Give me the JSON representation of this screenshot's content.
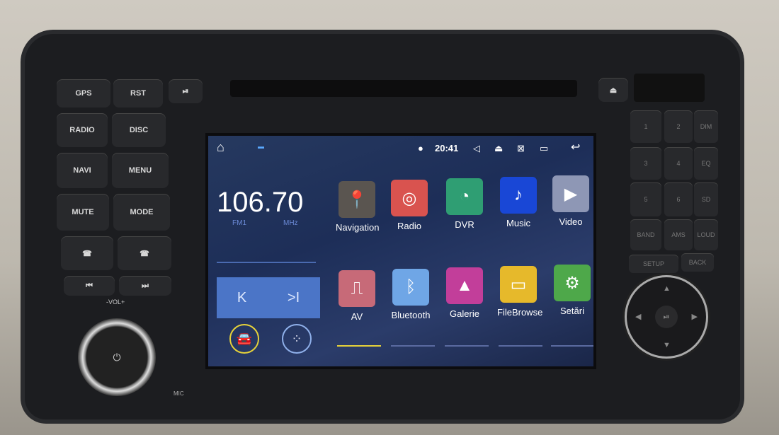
{
  "status_bar": {
    "time": "20:41",
    "icons": [
      "home-icon",
      "notification-icon",
      "location-icon",
      "volume-icon",
      "eject-icon",
      "close-screen-icon",
      "recent-apps-icon",
      "back-icon"
    ]
  },
  "radio": {
    "frequency": "106.70",
    "band": "FM1",
    "unit": "MHz"
  },
  "apps": [
    {
      "label": "Navigation",
      "icon": "location-pin-icon",
      "color": "#5a5550"
    },
    {
      "label": "Radio",
      "icon": "broadcast-icon",
      "color": "#d9534f"
    },
    {
      "label": "DVR",
      "icon": "gauge-icon",
      "color": "#2f9e73"
    },
    {
      "label": "Music",
      "icon": "music-note-icon",
      "color": "#1947d6"
    },
    {
      "label": "Video",
      "icon": "play-icon",
      "color": "#8e97b5"
    },
    {
      "label": "AV",
      "icon": "av-in-icon",
      "color": "#c76a78"
    },
    {
      "label": "Bluetooth",
      "icon": "bluetooth-icon",
      "color": "#6fa6e6"
    },
    {
      "label": "Galerie",
      "icon": "gallery-icon",
      "color": "#c23e9a"
    },
    {
      "label": "FileBrowse",
      "icon": "folder-icon",
      "color": "#e6b92b"
    },
    {
      "label": "Setări",
      "icon": "gear-icon",
      "color": "#4ea84a"
    }
  ],
  "left_buttons": [
    "GPS",
    "RST",
    "RADIO",
    "DISC",
    "NAVI",
    "MENU",
    "MUTE",
    "MODE",
    "⏮",
    "⏭"
  ],
  "knob_label": "-VOL+",
  "mic_label": "MIC",
  "keypad": [
    "1",
    "2",
    "DIM",
    "3",
    "4",
    "EQ",
    "5",
    "6",
    "SD",
    "BAND",
    "AMS",
    "LOUD",
    "SETUP",
    "BACK"
  ],
  "accent_color": "#e6d23a"
}
